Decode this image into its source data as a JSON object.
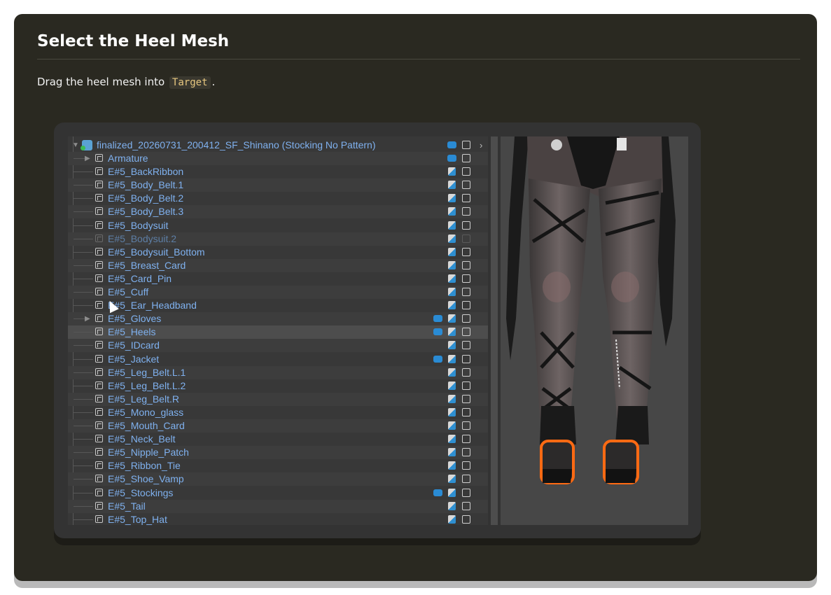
{
  "heading": "Select the Heel Mesh",
  "instruction": {
    "before": "Drag the heel mesh into ",
    "code": "Target",
    "after": "."
  },
  "hierarchy": {
    "root": "finalized_20260731_200412_SF_Shinano (Stocking No Pattern)",
    "selected": "E#5_Heels",
    "items": [
      {
        "label": "Armature",
        "expandable": true,
        "bone": true,
        "skin": false
      },
      {
        "label": "E#5_BackRibbon",
        "expandable": false,
        "bone": false,
        "skin": true
      },
      {
        "label": "E#5_Body_Belt.1",
        "expandable": false,
        "bone": false,
        "skin": true
      },
      {
        "label": "E#5_Body_Belt.2",
        "expandable": false,
        "bone": false,
        "skin": true
      },
      {
        "label": "E#5_Body_Belt.3",
        "expandable": false,
        "bone": false,
        "skin": true
      },
      {
        "label": "E#5_Bodysuit",
        "expandable": false,
        "bone": false,
        "skin": true
      },
      {
        "label": "E#5_Bodysuit.2",
        "expandable": false,
        "bone": false,
        "skin": true,
        "dimmed": true
      },
      {
        "label": "E#5_Bodysuit_Bottom",
        "expandable": false,
        "bone": false,
        "skin": true
      },
      {
        "label": "E#5_Breast_Card",
        "expandable": false,
        "bone": false,
        "skin": true
      },
      {
        "label": "E#5_Card_Pin",
        "expandable": false,
        "bone": false,
        "skin": true
      },
      {
        "label": "E#5_Cuff",
        "expandable": false,
        "bone": false,
        "skin": true
      },
      {
        "label": "E#5_Ear_Headband",
        "expandable": false,
        "bone": false,
        "skin": true
      },
      {
        "label": "E#5_Gloves",
        "expandable": true,
        "bone": true,
        "skin": true
      },
      {
        "label": "E#5_Heels",
        "expandable": false,
        "bone": true,
        "skin": true
      },
      {
        "label": "E#5_IDcard",
        "expandable": false,
        "bone": false,
        "skin": true
      },
      {
        "label": "E#5_Jacket",
        "expandable": false,
        "bone": true,
        "skin": true
      },
      {
        "label": "E#5_Leg_Belt.L.1",
        "expandable": false,
        "bone": false,
        "skin": true
      },
      {
        "label": "E#5_Leg_Belt.L.2",
        "expandable": false,
        "bone": false,
        "skin": true
      },
      {
        "label": "E#5_Leg_Belt.R",
        "expandable": false,
        "bone": false,
        "skin": true
      },
      {
        "label": "E#5_Mono_glass",
        "expandable": false,
        "bone": false,
        "skin": true
      },
      {
        "label": "E#5_Mouth_Card",
        "expandable": false,
        "bone": false,
        "skin": true
      },
      {
        "label": "E#5_Neck_Belt",
        "expandable": false,
        "bone": false,
        "skin": true
      },
      {
        "label": "E#5_Nipple_Patch",
        "expandable": false,
        "bone": false,
        "skin": true
      },
      {
        "label": "E#5_Ribbon_Tie",
        "expandable": false,
        "bone": false,
        "skin": true
      },
      {
        "label": "E#5_Shoe_Vamp",
        "expandable": false,
        "bone": false,
        "skin": true
      },
      {
        "label": "E#5_Stockings",
        "expandable": false,
        "bone": true,
        "skin": true
      },
      {
        "label": "E#5_Tail",
        "expandable": false,
        "bone": false,
        "skin": true
      },
      {
        "label": "E#5_Top_Hat",
        "expandable": false,
        "bone": false,
        "skin": true
      }
    ]
  },
  "colors": {
    "card_bg": "#2a2921",
    "hierarchy_text": "#7fb1ef",
    "highlight_outline": "#ff6a13"
  }
}
